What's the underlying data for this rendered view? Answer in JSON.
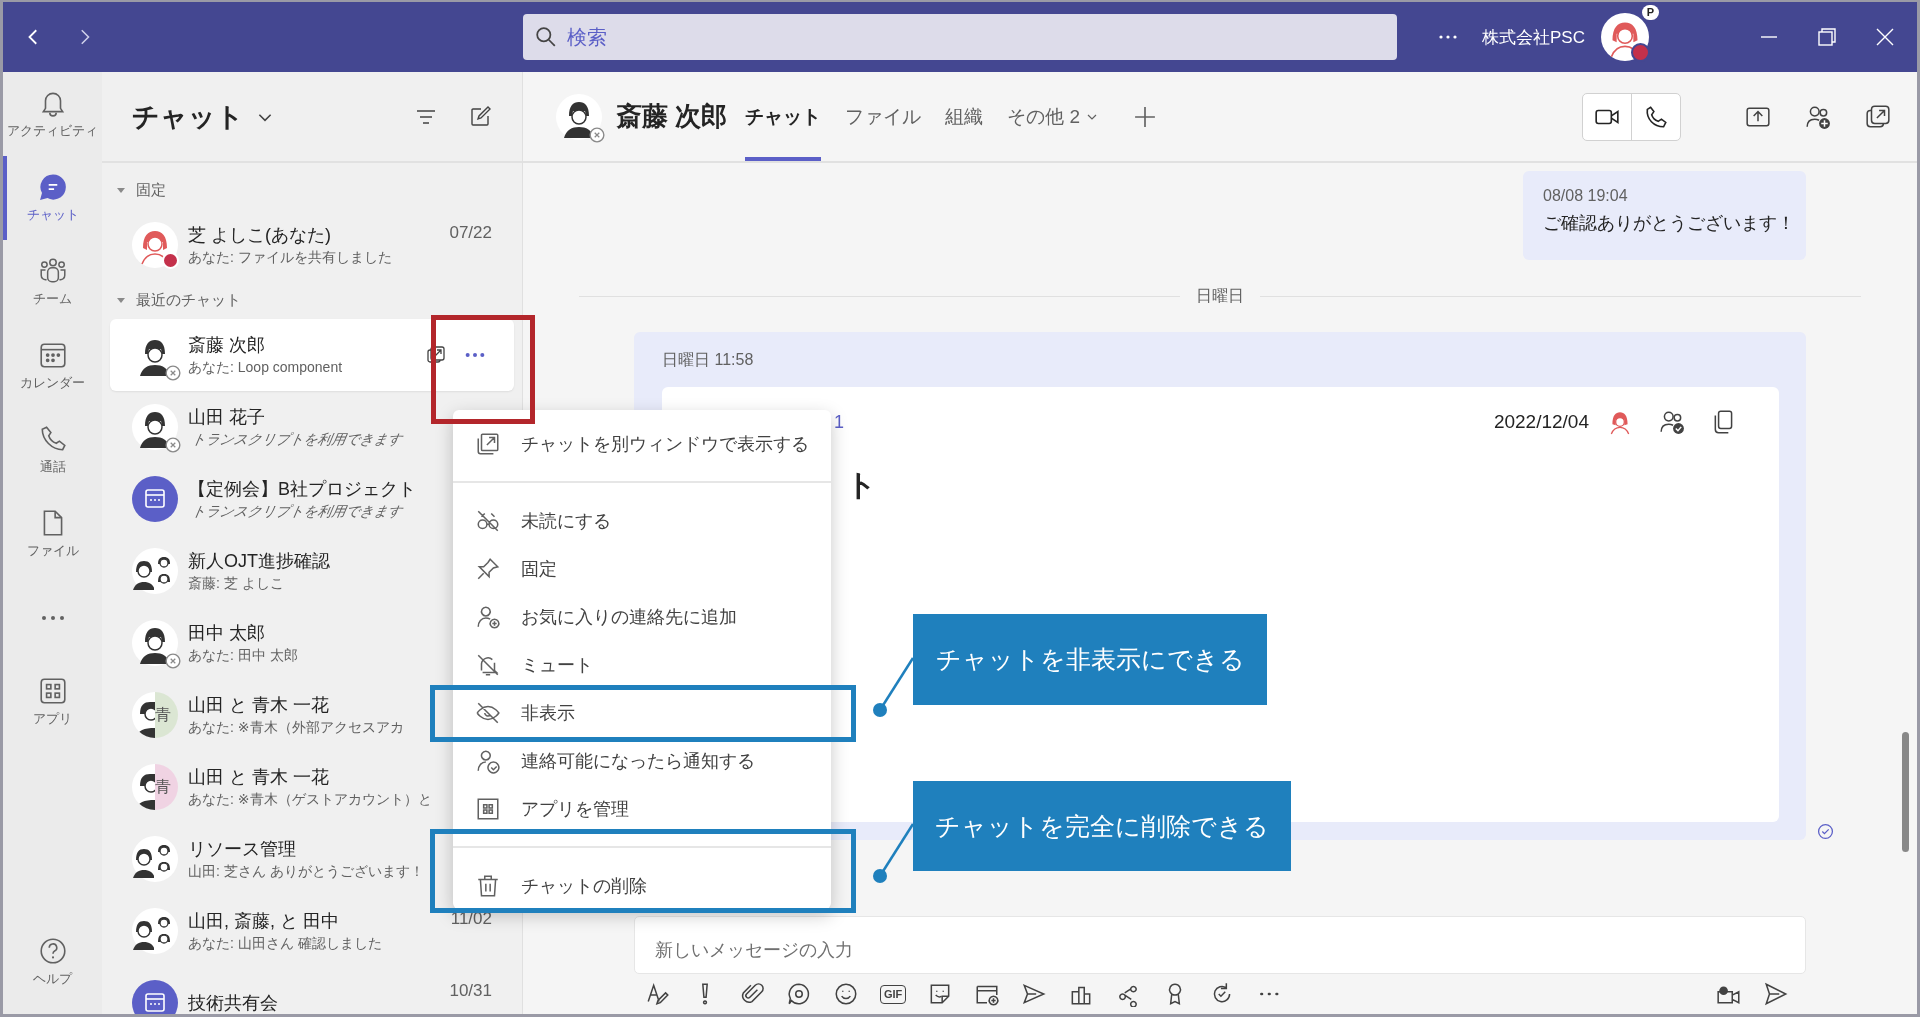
{
  "title_bar": {
    "search_placeholder": "検索",
    "org": "株式会社PSC",
    "avatar_badge": "P",
    "busy": true
  },
  "rail": [
    {
      "label": "アクティビティ",
      "selected": false
    },
    {
      "label": "チャット",
      "selected": true
    },
    {
      "label": "チーム",
      "selected": false
    },
    {
      "label": "カレンダー",
      "selected": false
    },
    {
      "label": "通話",
      "selected": false
    },
    {
      "label": "ファイル",
      "selected": false
    },
    {
      "selected": false
    },
    {
      "label": "アプリ",
      "selected": false
    }
  ],
  "rail_help": {
    "label": "ヘルプ"
  },
  "chat_list": {
    "title": "チャット",
    "sections": [
      {
        "label": "固定",
        "expanded": true,
        "items": [
          {
            "name": "芝 よしこ(あなた)",
            "preview": "あなた: ファイルを共有しました",
            "date": "07/22",
            "kind": "self",
            "busy": true,
            "offline": false,
            "italic": false,
            "selected": false
          }
        ]
      },
      {
        "label": "最近のチャット",
        "expanded": true,
        "items": [
          {
            "name": "斎藤 次郎",
            "preview": "あなた: Loop component",
            "kind": "person",
            "busy": false,
            "offline": true,
            "italic": false,
            "selected": true
          },
          {
            "name": "山田 花子",
            "preview": "トランスクリプトを利用できます",
            "kind": "person",
            "busy": false,
            "offline": true,
            "italic": true,
            "selected": false
          },
          {
            "name": "【定例会】B社プロジェクト",
            "preview": "トランスクリプトを利用できます",
            "kind": "meeting",
            "busy": false,
            "offline": false,
            "italic": true,
            "selected": false
          },
          {
            "name": "新人OJT進捗確認",
            "preview": "斎藤: 芝 よしこ",
            "kind": "group",
            "busy": false,
            "offline": false,
            "italic": false,
            "selected": false
          },
          {
            "name": "田中 太郎",
            "preview": "あなた: 田中 太郎",
            "kind": "person",
            "busy": false,
            "offline": true,
            "italic": false,
            "selected": false
          },
          {
            "name": "山田 と 青木 一花",
            "preview": "あなた: ※青木（外部アクセスアカ",
            "kind": "pair",
            "initial": "青",
            "color": "#dbe6d3",
            "busy": false,
            "offline": false,
            "italic": false,
            "selected": false
          },
          {
            "name": "山田 と 青木 一花",
            "preview": "あなた: ※青木（ゲストアカウント）と",
            "kind": "pair",
            "initial": "青",
            "color": "#f0d3e3",
            "busy": false,
            "offline": false,
            "italic": false,
            "selected": false
          },
          {
            "name": "リソース管理",
            "preview": "山田: 芝さん ありがとうございます！",
            "kind": "group",
            "busy": false,
            "offline": false,
            "italic": false,
            "selected": false
          },
          {
            "name": "山田, 斎藤, と 田中",
            "preview": "あなた: 山田さん 確認しました",
            "date": "11/02",
            "kind": "group",
            "busy": false,
            "offline": false,
            "italic": false,
            "selected": false
          },
          {
            "name": "技術共有会",
            "date": "10/31",
            "kind": "meeting",
            "busy": false,
            "offline": false,
            "selected": false
          }
        ]
      }
    ]
  },
  "conversation": {
    "name": "斎藤 次郎",
    "offline": true,
    "tabs": [
      {
        "label": "チャット",
        "selected": true,
        "kind": "tab"
      },
      {
        "label": "ファイル",
        "selected": false,
        "kind": "tab"
      },
      {
        "label": "組織",
        "selected": false,
        "kind": "tab"
      },
      {
        "label": "その他 2",
        "selected": false,
        "kind": "dropdown"
      }
    ],
    "messages": [
      {
        "kind": "mine",
        "time": "08/08 19:04",
        "text": "ご確認ありがとうございます！"
      },
      {
        "kind": "divider",
        "text": "日曜日"
      },
      {
        "kind": "loop",
        "time": "日曜日 11:58",
        "link": "1",
        "title": "ト",
        "date": "2022/12/04",
        "read": true
      }
    ],
    "compose": {
      "placeholder": "新しいメッセージの入力",
      "gif_label": "GIF"
    }
  },
  "context_menu": {
    "groups": [
      {
        "items": [
          {
            "label": "チャットを別ウィンドウで表示する"
          }
        ]
      },
      {
        "items": [
          {
            "label": "未読にする"
          },
          {
            "label": "固定"
          },
          {
            "label": "お気に入りの連絡先に追加"
          },
          {
            "label": "ミュート"
          },
          {
            "label": "非表示"
          },
          {
            "label": "連絡可能になったら通知する"
          },
          {
            "label": "アプリを管理"
          }
        ]
      },
      {
        "items": [
          {
            "label": "チャットの削除"
          }
        ]
      }
    ]
  },
  "annotations": {
    "boxes": [
      {
        "color": "#b3262b"
      },
      {
        "color": "#1f80bd"
      },
      {
        "color": "#1f80bd"
      }
    ],
    "callouts": [
      {
        "text": "チャットを非表示にできる",
        "color": "#1f80bd"
      },
      {
        "text": "チャットを完全に削除できる",
        "color": "#1f80bd"
      }
    ]
  }
}
